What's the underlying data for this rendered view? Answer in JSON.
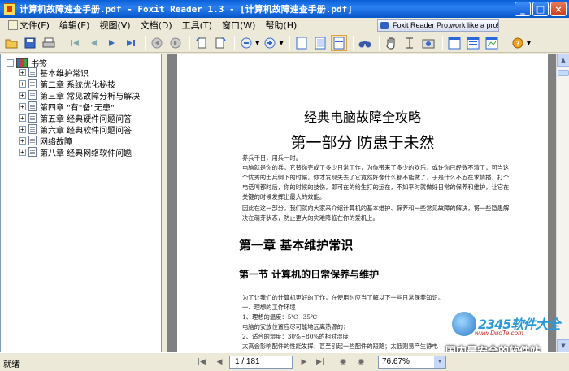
{
  "window": {
    "title": "计算机故障速查手册.pdf - Foxit Reader 1.3 - [计算机故障速查手册.pdf]",
    "min": "_",
    "max": "□",
    "close": "×"
  },
  "menu": {
    "items": [
      {
        "label": "文件(F)"
      },
      {
        "label": "编辑(E)"
      },
      {
        "label": "视图(V)"
      },
      {
        "label": "文档(D)"
      },
      {
        "label": "工具(T)"
      },
      {
        "label": "窗口(W)"
      },
      {
        "label": "帮助(H)"
      }
    ],
    "promo": "Foxit Reader Pro,work like a pro!"
  },
  "bookmarks": {
    "root": "书签",
    "items": [
      {
        "label": "基本维护常识"
      },
      {
        "label": "第二章  系统优化秘技"
      },
      {
        "label": "第三章  常见故障分析与解决"
      },
      {
        "label": "第四章 \"有\"备\"无患\""
      },
      {
        "label": "第五章  经典硬件问题问答"
      },
      {
        "label": "第六章  经典软件问题问答"
      },
      {
        "label": "网络故障"
      },
      {
        "label": "第八章   经典网络软件问题"
      }
    ]
  },
  "document": {
    "heading1": "经典电脑故障全攻略",
    "heading2": "第一部分  防患于未然",
    "paragraphs": [
      "     养兵千日，用兵一时。",
      "     电脑就是你的兵，它替你完成了多少日常工作，为你带来了多少的欢乐，或许你已经数不清了，可当这个忧秀的士兵倒下的时候，你才发现失去了它竟然好像什么都不能做了，于是什么不五在求情播，打个电话叫都时后，你的时候的技伤，即可在的给生打的运在，不如平时就做好日常的保养和维护，让它在关键的时候发挥出最大的效能。",
      "     因此在这一部分，我们就向大家来介绍计算机的基本维护、保养和一些常见故障的解决，将一些隐患解决在萌芽状态，防止更大的灾难降临在你的爱机上。"
    ],
    "chapter": "第一章  基本维护常识",
    "section": "第一节    计算机的日常保养与维护",
    "body": [
      "     为了让我们的计算机更好的工作，在使用时应当了解以下一些日常保养知识。",
      "     一、理想的工作环境",
      "     1、理想的温度：5℃~35℃",
      "     电脑的安放位置应尽可能地远离热源的；",
      "     2、适合的湿度：30%~80%的相对湿度",
      "     太高会影响配件的性能发挥，甚至引起一些配件的短路；太低则易产生静电"
    ]
  },
  "status": {
    "text": "就绪",
    "page": "1 / 181",
    "zoom": "76.67%"
  },
  "brand": {
    "name": "2345软件大全",
    "url": "www.DuoTe.com",
    "tagline": "国内最安全的软件站"
  }
}
